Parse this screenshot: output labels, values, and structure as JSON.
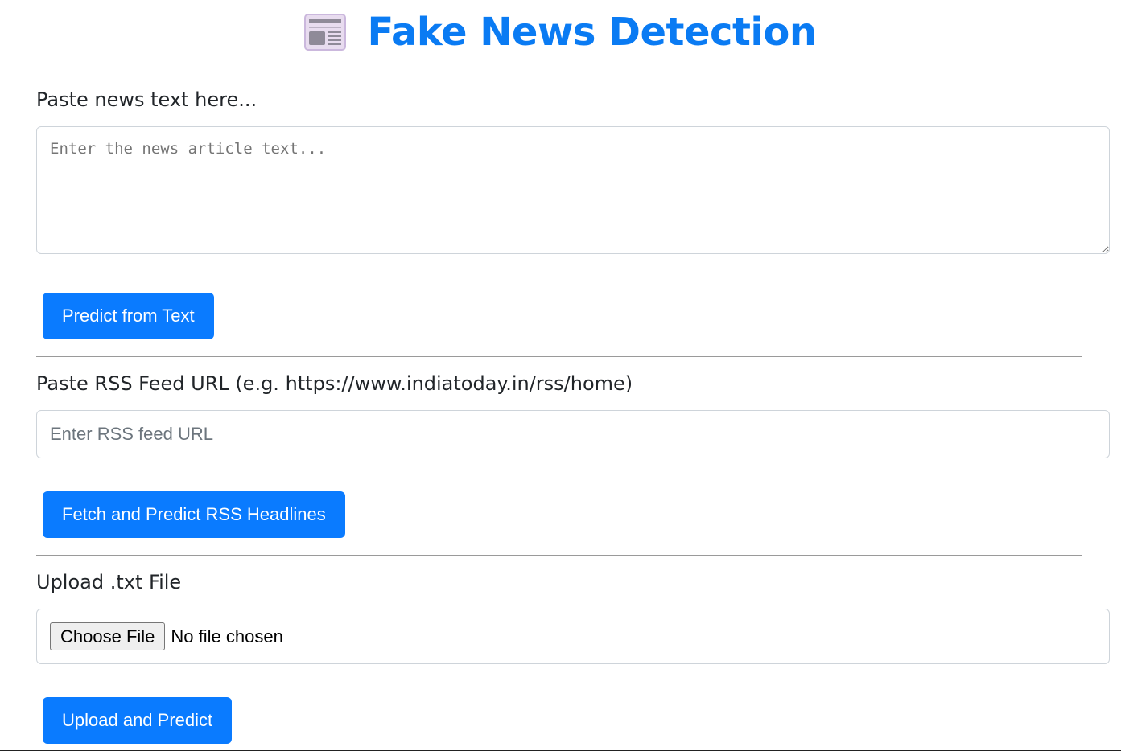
{
  "header": {
    "icon": "newspaper-icon",
    "title": "Fake News Detection"
  },
  "text_section": {
    "label": "Paste news text here...",
    "textarea_placeholder": "Enter the news article text...",
    "textarea_value": "",
    "button_label": "Predict from Text"
  },
  "rss_section": {
    "label": "Paste RSS Feed URL (e.g. https://www.indiatoday.in/rss/home)",
    "input_placeholder": "Enter RSS feed URL",
    "input_value": "",
    "button_label": "Fetch and Predict RSS Headlines"
  },
  "file_section": {
    "label": "Upload .txt File",
    "choose_button_label": "Choose File",
    "file_status": "No file chosen",
    "button_label": "Upload and Predict"
  },
  "colors": {
    "accent": "#0a7bff",
    "title": "#0a7bf3",
    "divider": "#9a9a9a"
  }
}
